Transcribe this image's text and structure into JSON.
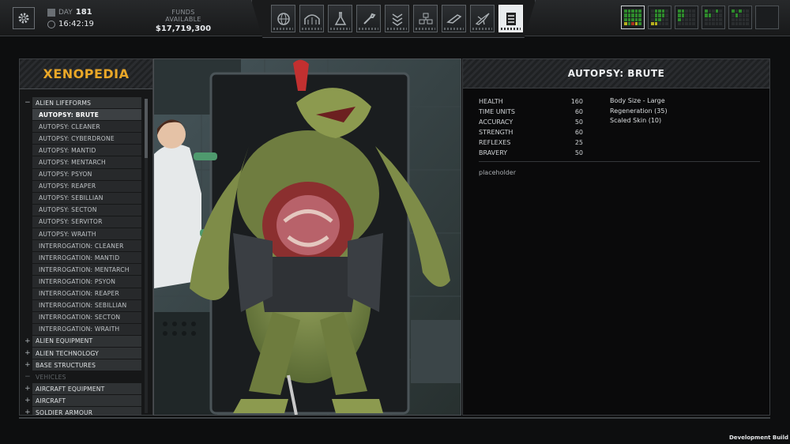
{
  "topbar": {
    "day_label": "DAY",
    "day_value": "181",
    "time": "16:42:19",
    "funds_label": "FUNDS AVAILABLE",
    "funds_value": "$17,719,300",
    "nav_icons": [
      "globe-icon",
      "hangar-icon",
      "research-icon",
      "engineering-icon",
      "soldier-rank-icon",
      "base-icon",
      "weapon-icon",
      "aircraft-icon",
      "xenopedia-icon"
    ],
    "active_nav_index": 8
  },
  "xenopedia": {
    "title": "XENOPEDIA",
    "tree": [
      {
        "label": "ALIEN LIFEFORMS",
        "toggle": "−",
        "type": "cat"
      },
      {
        "label": "AUTOPSY: BRUTE",
        "type": "sub",
        "selected": true
      },
      {
        "label": "AUTOPSY: CLEANER",
        "type": "sub"
      },
      {
        "label": "AUTOPSY: CYBERDRONE",
        "type": "sub"
      },
      {
        "label": "AUTOPSY: MANTID",
        "type": "sub"
      },
      {
        "label": "AUTOPSY: MENTARCH",
        "type": "sub"
      },
      {
        "label": "AUTOPSY: PSYON",
        "type": "sub"
      },
      {
        "label": "AUTOPSY: REAPER",
        "type": "sub"
      },
      {
        "label": "AUTOPSY: SEBILLIAN",
        "type": "sub"
      },
      {
        "label": "AUTOPSY: SECTON",
        "type": "sub"
      },
      {
        "label": "AUTOPSY: SERVITOR",
        "type": "sub"
      },
      {
        "label": "AUTOPSY: WRAITH",
        "type": "sub"
      },
      {
        "label": "INTERROGATION: CLEANER",
        "type": "sub"
      },
      {
        "label": "INTERROGATION: MANTID",
        "type": "sub"
      },
      {
        "label": "INTERROGATION: MENTARCH",
        "type": "sub"
      },
      {
        "label": "INTERROGATION: PSYON",
        "type": "sub"
      },
      {
        "label": "INTERROGATION: REAPER",
        "type": "sub"
      },
      {
        "label": "INTERROGATION: SEBILLIAN",
        "type": "sub"
      },
      {
        "label": "INTERROGATION: SECTON",
        "type": "sub"
      },
      {
        "label": "INTERROGATION: WRAITH",
        "type": "sub"
      },
      {
        "label": "ALIEN EQUIPMENT",
        "toggle": "+",
        "type": "cat"
      },
      {
        "label": "ALIEN TECHNOLOGY",
        "toggle": "+",
        "type": "cat"
      },
      {
        "label": "BASE STRUCTURES",
        "toggle": "+",
        "type": "cat"
      },
      {
        "label": "VEHICLES",
        "toggle": "−",
        "type": "dis"
      },
      {
        "label": "AIRCRAFT EQUIPMENT",
        "toggle": "+",
        "type": "cat"
      },
      {
        "label": "AIRCRAFT",
        "toggle": "+",
        "type": "cat"
      },
      {
        "label": "SOLDIER ARMOUR",
        "toggle": "+",
        "type": "cat"
      }
    ]
  },
  "entry": {
    "title": "AUTOPSY: BRUTE",
    "stats": [
      {
        "name": "HEALTH",
        "value": "160"
      },
      {
        "name": "TIME UNITS",
        "value": "60"
      },
      {
        "name": "ACCURACY",
        "value": "50"
      },
      {
        "name": "STRENGTH",
        "value": "60"
      },
      {
        "name": "REFLEXES",
        "value": "25"
      },
      {
        "name": "BRAVERY",
        "value": "50"
      }
    ],
    "traits": [
      "Body Size - Large",
      "Regeneration (35)",
      "Scaled Skin (10)"
    ],
    "description": "placeholder"
  },
  "footer": {
    "build_label": "Development Build"
  },
  "colors": {
    "accent": "#e9a728",
    "panel": "#161718",
    "active_button": "#e9ecee"
  }
}
